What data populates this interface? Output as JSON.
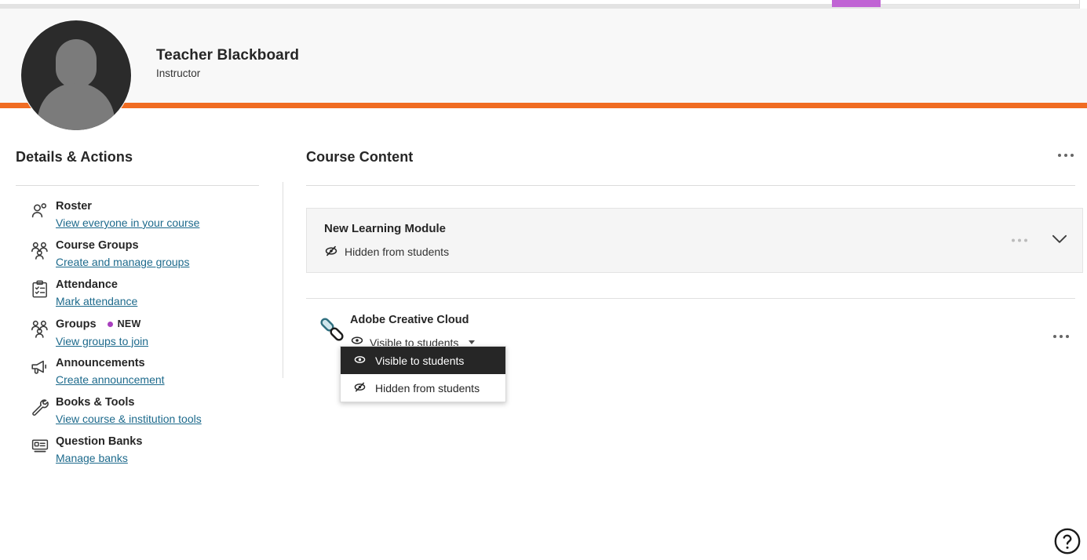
{
  "topbar": {
    "progress_label": ""
  },
  "banner": {
    "avatar_name": "avatar",
    "name": "Teacher Blackboard",
    "role": "Instructor",
    "accent_color": "#f06c22"
  },
  "sidebar": {
    "title": "Details & Actions",
    "items": [
      {
        "icon": "person-icon",
        "title": "Roster",
        "link": "View everyone in your course",
        "badge": ""
      },
      {
        "icon": "people-icon",
        "title": "Course Groups",
        "link": "Create and manage groups",
        "badge": ""
      },
      {
        "icon": "clipboard-icon",
        "title": "Attendance",
        "link": "Mark attendance",
        "badge": ""
      },
      {
        "icon": "people-icon",
        "title": "Groups",
        "link": "View groups to join",
        "badge": "NEW"
      },
      {
        "icon": "megaphone-icon",
        "title": "Announcements",
        "link": "Create announcement",
        "badge": ""
      },
      {
        "icon": "wrench-icon",
        "title": "Books & Tools",
        "link": "View course & institution tools",
        "badge": ""
      },
      {
        "icon": "question-bank-icon",
        "title": "Question Banks",
        "link": "Manage banks",
        "badge": ""
      }
    ],
    "badge_color": "#a83fbe",
    "link_color": "#1d6a8c"
  },
  "content": {
    "title": "Course Content",
    "module": {
      "title": "New Learning Module",
      "status": "Hidden from students",
      "status_icon": "eye-slash-icon"
    },
    "link_item": {
      "icon": "chain-link-icon",
      "title": "Adobe Creative Cloud",
      "visibility": "Visible to students",
      "visibility_icon": "eye-icon"
    },
    "dropdown": {
      "options": [
        {
          "label": "Visible to students",
          "icon": "eye-icon",
          "selected": true
        },
        {
          "label": "Hidden from students",
          "icon": "eye-slash-icon",
          "selected": false
        }
      ],
      "selected_bg": "#262626"
    }
  },
  "help": {
    "icon": "help-circle-icon",
    "label": "Help"
  }
}
